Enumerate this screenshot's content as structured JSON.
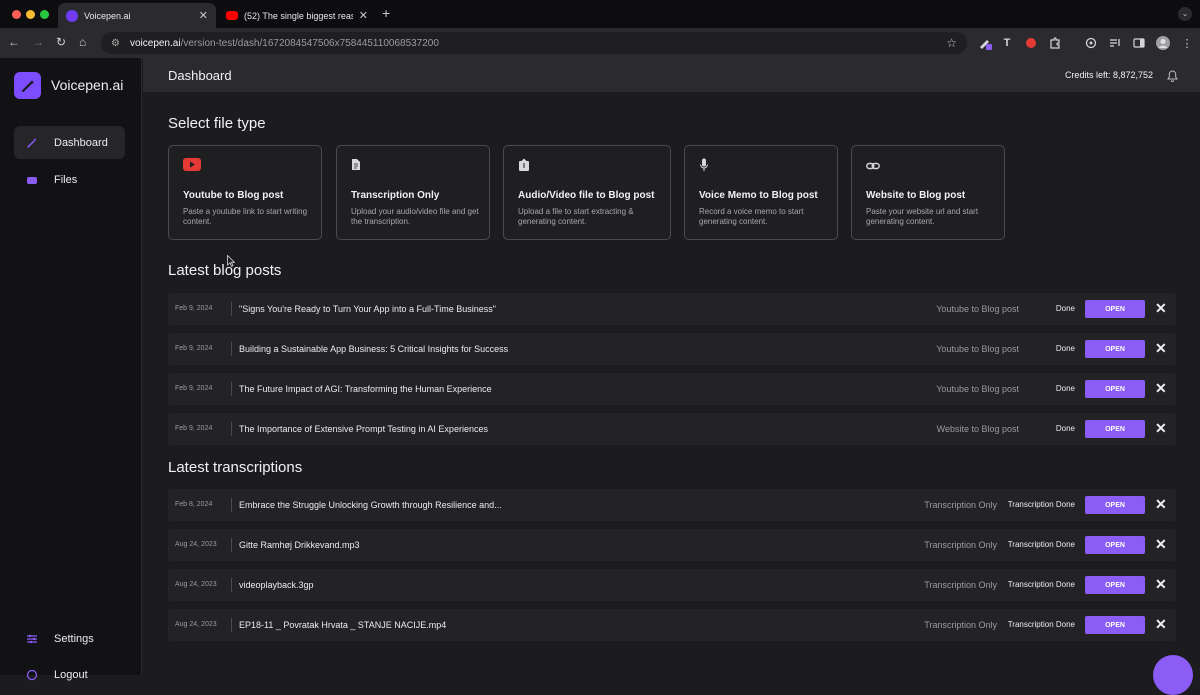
{
  "browser": {
    "tabs": [
      {
        "title": "Voicepen.ai",
        "active": true,
        "favicon": "voicepen-favicon"
      },
      {
        "title": "(52) The single biggest reaso",
        "active": false,
        "favicon": "youtube-favicon"
      }
    ],
    "url_host": "voicepen.ai",
    "url_path": "/version-test/dash/1672084547506x758445110068537200"
  },
  "app": {
    "name": "Voicepen.ai",
    "accent_color": "#8b5cf6"
  },
  "sidebar": {
    "items": [
      {
        "label": "Dashboard",
        "icon": "magic-wand-icon",
        "active": true
      },
      {
        "label": "Files",
        "icon": "folder-icon",
        "active": false
      }
    ],
    "bottom_items": [
      {
        "label": "Settings",
        "icon": "sliders-icon"
      },
      {
        "label": "Logout",
        "icon": "logout-icon"
      }
    ]
  },
  "header": {
    "title": "Dashboard",
    "credits": "Credits left: 8,872,752"
  },
  "file_types": {
    "title": "Select file type",
    "cards": [
      {
        "title": "Youtube to Blog post",
        "desc": "Paste a youtube link to start writing content.",
        "icon": "youtube-icon"
      },
      {
        "title": "Transcription Only",
        "desc": "Upload your audio/video file and get the transcription.",
        "icon": "document-icon"
      },
      {
        "title": "Audio/Video file to Blog post",
        "desc": "Upload a file to start extracting & generating content.",
        "icon": "upload-icon"
      },
      {
        "title": "Voice Memo to Blog post",
        "desc": "Record a voice memo to start generating content.",
        "icon": "microphone-icon"
      },
      {
        "title": "Website to Blog post",
        "desc": "Paste your website url and start generating content.",
        "icon": "link-icon"
      }
    ]
  },
  "blog_posts": {
    "title": "Latest blog posts",
    "rows": [
      {
        "date": "Feb 9, 2024",
        "title": "\"Signs You're Ready to Turn Your App into a Full-Time Business\"",
        "type": "Youtube to Blog post",
        "status": "Done",
        "action": "OPEN"
      },
      {
        "date": "Feb 9, 2024",
        "title": "Building a Sustainable App Business: 5 Critical Insights for Success",
        "type": "Youtube to Blog post",
        "status": "Done",
        "action": "OPEN"
      },
      {
        "date": "Feb 9, 2024",
        "title": "The Future Impact of AGI: Transforming the Human Experience",
        "type": "Youtube to Blog post",
        "status": "Done",
        "action": "OPEN"
      },
      {
        "date": "Feb 9, 2024",
        "title": "The Importance of Extensive Prompt Testing in AI Experiences",
        "type": "Website to Blog post",
        "status": "Done",
        "action": "OPEN"
      }
    ]
  },
  "transcriptions": {
    "title": "Latest transcriptions",
    "rows": [
      {
        "date": "Feb 8, 2024",
        "title": "Embrace the Struggle Unlocking Growth through Resilience and...",
        "type": "Transcription Only",
        "status": "Transcription Done",
        "action": "OPEN"
      },
      {
        "date": "Aug 24, 2023",
        "title": "Gitte Ramhøj Drikkevand.mp3",
        "type": "Transcription Only",
        "status": "Transcription Done",
        "action": "OPEN"
      },
      {
        "date": "Aug 24, 2023",
        "title": "videoplayback.3gp",
        "type": "Transcription Only",
        "status": "Transcription Done",
        "action": "OPEN"
      },
      {
        "date": "Aug 24, 2023",
        "title": "EP18-11 _ Povratak Hrvata _ STANJE NACIJE.mp4",
        "type": "Transcription Only",
        "status": "Transcription Done",
        "action": "OPEN"
      }
    ]
  }
}
